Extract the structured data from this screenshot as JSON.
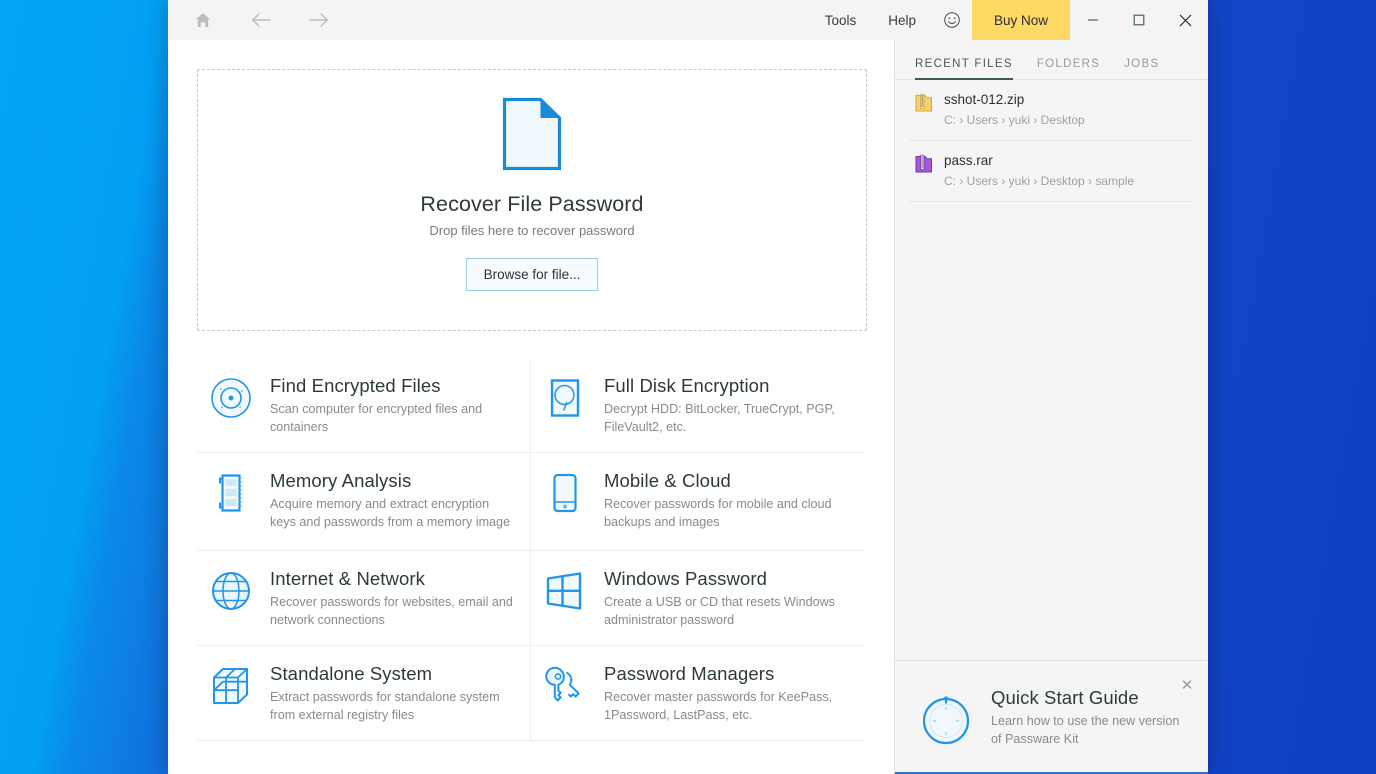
{
  "titlebar": {
    "home_icon": "home-icon",
    "back_icon": "arrow-left-icon",
    "forward_icon": "arrow-right-icon",
    "tools_label": "Tools",
    "help_label": "Help",
    "feedback_icon": "smiley-face-icon",
    "buy_now_label": "Buy Now",
    "minimize_label": "—",
    "maximize_label": "▢",
    "close_label": "✕",
    "buy_now_color": "#ffd966"
  },
  "dropzone": {
    "icon": "document-file-icon",
    "title": "Recover File Password",
    "subtitle": "Drop files here to recover password",
    "button_label": "Browse for file..."
  },
  "tiles": [
    {
      "icon": "radar-target-icon",
      "title": "Find Encrypted Files",
      "desc": "Scan computer for encrypted files and containers"
    },
    {
      "icon": "hard-disk-icon",
      "title": "Full Disk Encryption",
      "desc": "Decrypt HDD: BitLocker, TrueCrypt, PGP, FileVault2, etc."
    },
    {
      "icon": "memory-ram-stick-icon",
      "title": "Memory Analysis",
      "desc": "Acquire memory and extract encryption keys and passwords from a memory image"
    },
    {
      "icon": "mobile-phone-icon",
      "title": "Mobile & Cloud",
      "desc": "Recover passwords for mobile and cloud backups and images"
    },
    {
      "icon": "globe-network-icon",
      "title": "Internet & Network",
      "desc": "Recover passwords for websites, email and network connections"
    },
    {
      "icon": "windows-logo-icon",
      "title": "Windows Password",
      "desc": "Create a USB or CD that resets Windows administrator password"
    },
    {
      "icon": "cube-blocks-icon",
      "title": "Standalone System",
      "desc": "Extract passwords for standalone system from external registry files"
    },
    {
      "icon": "keys-icon",
      "title": "Password Managers",
      "desc": "Recover master passwords for KeePass, 1Password, LastPass, etc."
    }
  ],
  "sidebar": {
    "tabs": [
      {
        "label": "RECENT FILES",
        "active": true
      },
      {
        "label": "FOLDERS",
        "active": false
      },
      {
        "label": "JOBS",
        "active": false
      }
    ],
    "active_tab_underline_color": "#3d5c46",
    "files": [
      {
        "icon": "zip-archive-icon",
        "name": "sshot-012.zip",
        "path": "C: › Users › yuki › Desktop"
      },
      {
        "icon": "rar-archive-icon",
        "name": "pass.rar",
        "path": "C: › Users › yuki › Desktop › sample"
      }
    ],
    "quick_start": {
      "icon": "compass-icon",
      "title": "Quick Start Guide",
      "desc": "Learn how to use the new version of Passware Kit",
      "close_icon": "close-icon",
      "close_label": "✕"
    }
  }
}
